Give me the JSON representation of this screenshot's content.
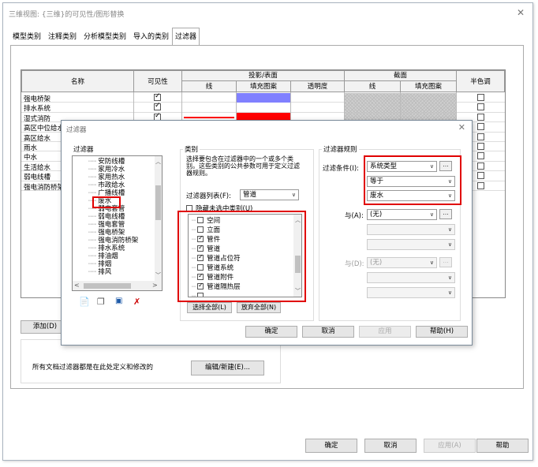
{
  "window": {
    "title": "三维视图: {三维}的可见性/图形替换"
  },
  "tabs": [
    "模型类别",
    "注释类别",
    "分析模型类别",
    "导入的类别",
    "过滤器"
  ],
  "active_tab_index": 4,
  "grid": {
    "headers": {
      "name": "名称",
      "visibility": "可见性",
      "projection_surface": "投影/表面",
      "cut": "截面",
      "halftone": "半色调",
      "line": "线",
      "fill_pattern": "填充图案",
      "transparency": "透明度",
      "cut_line": "线",
      "cut_fill": "填充图案"
    },
    "rows": [
      {
        "name": "强电桥架",
        "visible": true,
        "fill_color": "#8080ff",
        "line_color": "",
        "halftone": false
      },
      {
        "name": "排水系统",
        "visible": true,
        "fill_color": "",
        "line_color": "",
        "halftone": false
      },
      {
        "name": "湿式消防",
        "visible": true,
        "fill_color": "#ff0000",
        "line_color": "#ff0000",
        "halftone": false
      },
      {
        "name": "高区中位给水",
        "visible": true,
        "fill_color": "",
        "line_color": "",
        "halftone": false
      },
      {
        "name": "高区给水",
        "visible": true,
        "fill_color": "",
        "line_color": "",
        "halftone": false
      },
      {
        "name": "雨水",
        "visible": true,
        "fill_color": "",
        "line_color": "",
        "halftone": false
      },
      {
        "name": "中水",
        "visible": true,
        "fill_color": "",
        "line_color": "",
        "halftone": false
      },
      {
        "name": "生活给水",
        "visible": true,
        "fill_color": "",
        "line_color": "",
        "halftone": false
      },
      {
        "name": "弱电线槽",
        "visible": true,
        "fill_color": "",
        "line_color": "",
        "halftone": false
      },
      {
        "name": "强电消防桥架",
        "visible": true,
        "fill_color": "",
        "line_color": "",
        "halftone": false
      }
    ]
  },
  "add_button": "添加(D)",
  "info_text": "所有文档过滤器都是在此处定义和修改的",
  "edit_new_button": "编辑/新建(E)...",
  "footer": {
    "ok": "确定",
    "cancel": "取消",
    "apply": "应用(A)",
    "help": "帮助"
  },
  "filter_dialog": {
    "title": "过滤器",
    "filters_label": "过滤器",
    "filters": [
      "安防线槽",
      "家用冷水",
      "家用热水",
      "市政给水",
      "广播线槽",
      "废水",
      "弱电套管",
      "弱电线槽",
      "强电套管",
      "强电桥架",
      "强电消防桥架",
      "排水系统",
      "排油烟",
      "排烟",
      "排风"
    ],
    "selected_filter": "废水",
    "categories_label": "类别",
    "categories_desc": "选择要包含在过滤器中的一个或多个类别。这些类别的公共参数可用于定义过滤器规则。",
    "filter_list_label": "过滤器列表(F):",
    "filter_list_value": "管道",
    "hide_unchecked_label": "隐藏未选中类别(U)",
    "categories": [
      {
        "label": "空间",
        "checked": false
      },
      {
        "label": "立面",
        "checked": false
      },
      {
        "label": "管件",
        "checked": true
      },
      {
        "label": "管道",
        "checked": true
      },
      {
        "label": "管道占位符",
        "checked": true
      },
      {
        "label": "管道系统",
        "checked": false
      },
      {
        "label": "管道附件",
        "checked": true
      },
      {
        "label": "管道隔热层",
        "checked": true
      },
      {
        "label": "...",
        "checked": false
      }
    ],
    "select_all": "选择全部(L)",
    "deselect_all": "放弃全部(N)",
    "rules_label": "过滤器规则",
    "filter_by_label": "过滤条件(I):",
    "rule_param": "系统类型",
    "rule_operator": "等于",
    "rule_value": "废水",
    "and1_label": "与(A):",
    "and1_value": "(无)",
    "and2_label": "与(D):",
    "and2_value": "(无)",
    "ok": "确定",
    "cancel": "取消",
    "apply": "应用",
    "help": "帮助(H)"
  },
  "colors": {
    "highlight_red": "#e00000",
    "blue_fill": "#8080ff",
    "red_fill": "#ff0000"
  }
}
